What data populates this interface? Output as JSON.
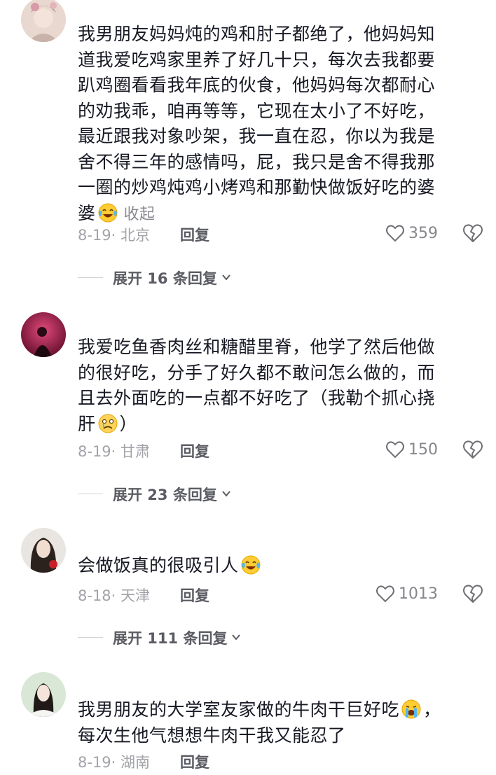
{
  "comments": [
    {
      "text": "我男朋友妈妈炖的鸡和肘子都绝了，他妈妈知道我爱吃鸡家里养了好几十只，每次去我都要趴鸡圈看看我年底的伙食，他妈妈每次都耐心的劝我乖，咱再等等，它现在太小了不好吃，最近跟我对象吵架，我一直在忍，你以为我是舍不得三年的感情吗，屁，我只是舍不得我那一圈的炒鸡炖鸡小烤鸡和那勤快做饭好吃的婆婆",
      "lines": [
        "我男朋友妈妈炖的鸡和肘子都绝了，他妈妈知",
        "道我爱吃鸡家里养了好几十只，每次去我都要",
        "趴鸡圈看看我年底的伙食，他妈妈每次都耐心",
        "的劝我乖，咱再等等，它现在太小了不好吃，",
        "最近跟我对象吵架，我一直在忍，你以为我是",
        "舍不得三年的感情吗，屁，我只是舍不得我那",
        "一圈的炒鸡炖鸡小烤鸡和那勤快做饭好吃的婆",
        "婆"
      ],
      "emoji": "laugh-cry-icon",
      "collapse_label": "收起",
      "date": "8-19",
      "location": "北京",
      "reply_label": "回复",
      "likes": "359",
      "expand_label": "展开 16 条回复"
    },
    {
      "lines": [
        "我爱吃鱼香肉丝和糖醋里脊，他学了然后他做",
        "的很好吃，分手了好久都不敢问怎么做的，而",
        "且去外面吃的一点都不好吃了（我勒个抓心挠",
        "肝"
      ],
      "tail": "）",
      "emoji": "crying-icon",
      "date": "8-19",
      "location": "甘肃",
      "reply_label": "回复",
      "likes": "150",
      "expand_label": "展开 23 条回复"
    },
    {
      "lines": [
        "会做饭真的很吸引人"
      ],
      "emoji": "laugh-cry-icon",
      "date": "8-18",
      "location": "天津",
      "reply_label": "回复",
      "likes": "1013",
      "expand_label": "展开 111 条回复"
    },
    {
      "lines": [
        "我男朋友的大学室友家做的牛肉干巨好吃",
        "每次生他气想想牛肉干我又能忍了"
      ],
      "tail": "，",
      "emoji": "sob-icon",
      "date": "8-19",
      "location": "湖南",
      "reply_label": "回复"
    }
  ],
  "colors": {
    "text": "#161823",
    "meta": "#a2a3a8",
    "reply": "#5b5c63"
  }
}
